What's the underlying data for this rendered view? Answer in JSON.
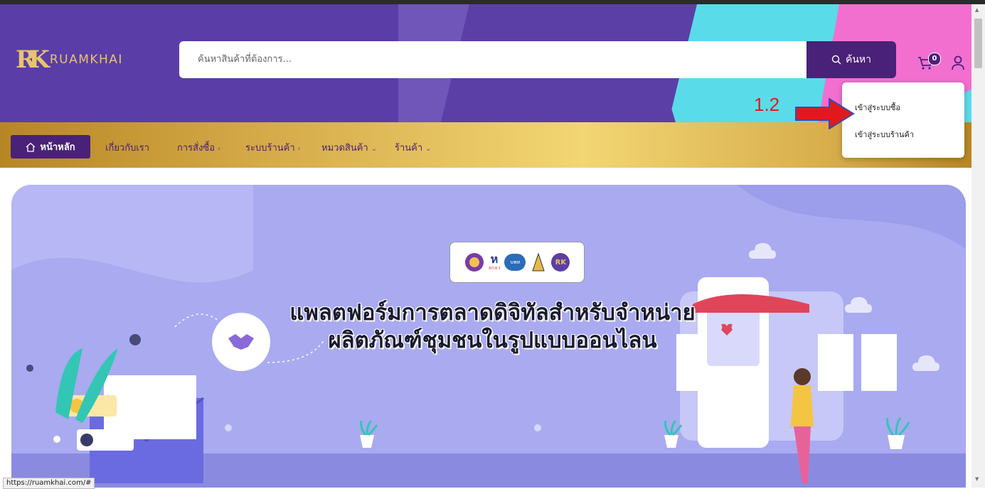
{
  "header": {
    "brand": "RUAMKHAI",
    "logo_mark": "RK",
    "search": {
      "placeholder": "ค้นหาสินค้าที่ต้องการ...",
      "button_label": "ค้นหา"
    },
    "cart_count": "0"
  },
  "account_menu": {
    "items": [
      {
        "label": "เข้าสู่ระบบซื้อ"
      },
      {
        "label": "เข้าสู่ระบบร้านค้า"
      }
    ]
  },
  "annotation": {
    "label": "1.2",
    "arrow_color": "#e01a1a"
  },
  "nav": {
    "home": "หน้าหลัก",
    "items": [
      {
        "label": "เกี่ยวกับเรา"
      },
      {
        "label": "การสั่งซื้อ"
      },
      {
        "label": "ระบบร้านค้า"
      },
      {
        "label": "หมวดสินค้า"
      },
      {
        "label": "ร้านค้า"
      }
    ]
  },
  "hero": {
    "line1": "แพลตฟอร์มการตลาดดิจิทัลสำหรับจำหน่าย",
    "line2": "ผลิตภัณฑ์ชุมชนในรูปแบบออนไลน",
    "partner_logos": {
      "logo2_text": "ลกลว",
      "logo3_text": "บพท",
      "logo5_text": "RK"
    }
  },
  "status_bar": "https://ruamkhai.com/#",
  "colors": {
    "primary": "#4a2178",
    "header_bg": "#5b3fa6",
    "hero_bg": "#a9aaf0",
    "gold": "#d8ae4c"
  }
}
